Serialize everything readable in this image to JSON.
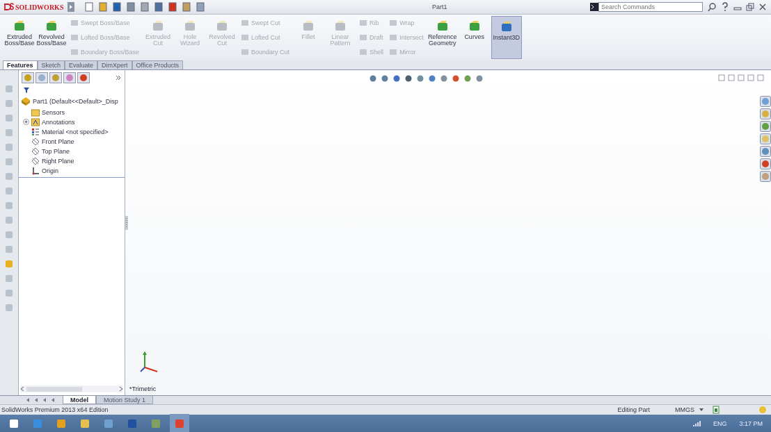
{
  "title_bar": {
    "app": "SOLIDWORKS",
    "document": "Part1",
    "search": {
      "placeholder": "Search Commands"
    }
  },
  "ribbon": [
    {
      "kind": "large",
      "label": "Extruded Boss/Base",
      "disabled": false,
      "selected": false
    },
    {
      "kind": "large",
      "label": "Revolved Boss/Base",
      "disabled": false,
      "selected": false
    },
    {
      "kind": "stack",
      "items": [
        {
          "label": "Swept Boss/Base",
          "disabled": true
        },
        {
          "label": "Lofted Boss/Base",
          "disabled": true
        },
        {
          "label": "Boundary Boss/Base",
          "disabled": true
        }
      ]
    },
    {
      "kind": "large",
      "label": "Extruded Cut",
      "disabled": true,
      "selected": false
    },
    {
      "kind": "large",
      "label": "Hole Wizard",
      "disabled": true,
      "selected": false
    },
    {
      "kind": "large",
      "label": "Revolved Cut",
      "disabled": true,
      "selected": false
    },
    {
      "kind": "stack",
      "items": [
        {
          "label": "Swept Cut",
          "disabled": true
        },
        {
          "label": "Lofted Cut",
          "disabled": true
        },
        {
          "label": "Boundary Cut",
          "disabled": true
        }
      ]
    },
    {
      "kind": "large",
      "label": "Fillet",
      "disabled": true,
      "selected": false
    },
    {
      "kind": "large",
      "label": "Linear Pattern",
      "disabled": true,
      "selected": false
    },
    {
      "kind": "stack",
      "items": [
        {
          "label": "Rib",
          "disabled": true
        },
        {
          "label": "Draft",
          "disabled": true
        },
        {
          "label": "Shell",
          "disabled": true
        }
      ]
    },
    {
      "kind": "stack",
      "items": [
        {
          "label": "Wrap",
          "disabled": true
        },
        {
          "label": "Intersect",
          "disabled": true
        },
        {
          "label": "Mirror",
          "disabled": true
        }
      ]
    },
    {
      "kind": "large",
      "label": "Reference Geometry",
      "disabled": false,
      "selected": false
    },
    {
      "kind": "large",
      "label": "Curves",
      "disabled": false,
      "selected": false
    },
    {
      "kind": "large",
      "label": "Instant3D",
      "disabled": false,
      "selected": true
    }
  ],
  "tabs": [
    {
      "label": "Features",
      "selected": true
    },
    {
      "label": "Sketch",
      "selected": false
    },
    {
      "label": "Evaluate",
      "selected": false
    },
    {
      "label": "DimXpert",
      "selected": false
    },
    {
      "label": "Office Products",
      "selected": false
    }
  ],
  "feature_tree": {
    "root": "Part1  (Default<<Default>_Disp",
    "children": [
      {
        "kind": "sensors",
        "label": "Sensors"
      },
      {
        "kind": "annotations",
        "label": "Annotations",
        "expanded": false
      },
      {
        "kind": "material",
        "label": "Material <not specified>"
      },
      {
        "kind": "plane",
        "label": "Front Plane"
      },
      {
        "kind": "plane",
        "label": "Top Plane"
      },
      {
        "kind": "plane",
        "label": "Right Plane"
      },
      {
        "kind": "origin",
        "label": "Origin"
      }
    ]
  },
  "viewport": {
    "view_label": "*Trimetric"
  },
  "bottom_tabs": [
    {
      "label": "Model",
      "selected": true
    },
    {
      "label": "Motion Study 1",
      "selected": false
    }
  ],
  "status_bar": {
    "edition": "SolidWorks Premium 2013 x64 Edition",
    "mode": "Editing Part",
    "units": "MMGS"
  },
  "taskbar": {
    "language": "ENG",
    "time": "3:17 PM"
  }
}
